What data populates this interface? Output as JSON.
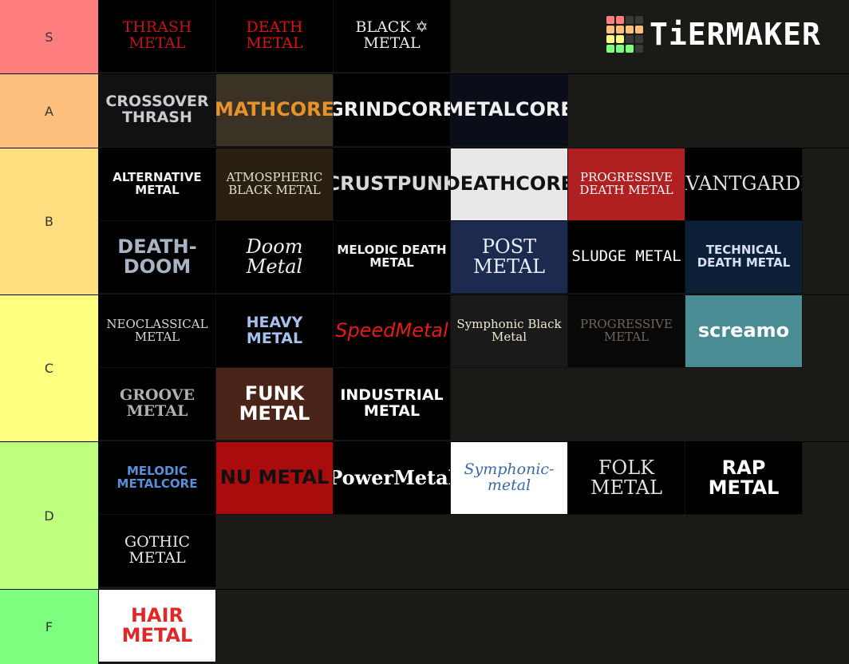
{
  "brand": {
    "name": "TiERMAKER",
    "grid_colors": [
      "#ff7f7f",
      "#ff7f7f",
      "#3a3a3a",
      "#3a3a3a",
      "#ffbf7f",
      "#ffbf7f",
      "#ffbf7f",
      "#ffbf7f",
      "#ffff7f",
      "#ffff7f",
      "#3a3a3a",
      "#3a3a3a",
      "#7fff7f",
      "#7fff7f",
      "#7fff7f",
      "#3a3a3a"
    ]
  },
  "tiers": [
    {
      "label": "S",
      "color": "#ff7f7f",
      "items": [
        {
          "text": "THRASH METAL",
          "fg": "#c0141a",
          "bg": "#000000",
          "font": "serif"
        },
        {
          "text": "DEATH METAL",
          "fg": "#e01010",
          "bg": "#000000",
          "font": "serif"
        },
        {
          "text": "BLACK ✡ METAL",
          "fg": "#e8e8e8",
          "bg": "#000000",
          "font": "serif"
        }
      ]
    },
    {
      "label": "A",
      "color": "#ffbf7f",
      "items": [
        {
          "text": "CROSSOVER THRASH",
          "fg": "#c8ccd0",
          "bg": "#111111",
          "font": "sans"
        },
        {
          "text": "MATHCORE",
          "fg": "#e8922a",
          "bg": "#3a3224",
          "font": "sans"
        },
        {
          "text": "GRINDCORE",
          "fg": "#f0f0f0",
          "bg": "#000000",
          "font": "sans"
        },
        {
          "text": "METALCORE",
          "fg": "#f0f0f0",
          "bg": "#0a0e18",
          "font": "sans"
        }
      ]
    },
    {
      "label": "B",
      "color": "#ffdf7f",
      "items": [
        {
          "text": "ALTERNATIVE METAL",
          "fg": "#f0f0f0",
          "bg": "#000000",
          "font": "sans"
        },
        {
          "text": "ATMOSPHERIC BLACK METAL",
          "fg": "#e6e0d0",
          "bg": "#2a2010",
          "font": "serif"
        },
        {
          "text": "CRUSTPUNK",
          "fg": "#d8d8d8",
          "bg": "#000000",
          "font": "sans"
        },
        {
          "text": "DEATHCORE",
          "fg": "#111111",
          "bg": "#e8e8e8",
          "font": "sans"
        },
        {
          "text": "PROGRESSIVE DEATH METAL",
          "fg": "#ffffff",
          "bg": "#b02020",
          "font": "serif"
        },
        {
          "text": "AVANTGARDE",
          "fg": "#e0e0e0",
          "bg": "#000000",
          "font": "serif"
        },
        {
          "text": "DEATH-DOOM",
          "fg": "#a8b4c4",
          "bg": "#000000",
          "font": "sans"
        },
        {
          "text": "Doom Metal",
          "fg": "#f0f0f0",
          "bg": "#000000",
          "font": "serif-italic"
        },
        {
          "text": "MELODIC DEATH METAL",
          "fg": "#f0f0f0",
          "bg": "#000000",
          "font": "sans"
        },
        {
          "text": "POST METAL",
          "fg": "#e8eef8",
          "bg": "#1c2a50",
          "font": "serif"
        },
        {
          "text": "SLUDGE METAL",
          "fg": "#ffffff",
          "bg": "#000000",
          "font": "mono"
        },
        {
          "text": "TECHNICAL DEATH METAL",
          "fg": "#d8e0f0",
          "bg": "#0c2038",
          "font": "sans"
        }
      ]
    },
    {
      "label": "C",
      "color": "#ffff7f",
      "items": [
        {
          "text": "NEOCLASSICAL METAL",
          "fg": "#d8d8d8",
          "bg": "#000000",
          "font": "serif"
        },
        {
          "text": "HEAVY METAL",
          "fg": "#a8c0f0",
          "bg": "#000000",
          "font": "sans"
        },
        {
          "text": "SpeedMetal",
          "fg": "#e81818",
          "bg": "#000000",
          "font": "sans-italic"
        },
        {
          "text": "Symphonic Black Metal",
          "fg": "#ecead0",
          "bg": "#1a1a1a",
          "font": "serif"
        },
        {
          "text": "PROGRESSIVE METAL",
          "fg": "#6e6658",
          "bg": "#080808",
          "font": "serif"
        },
        {
          "text": "screamo",
          "fg": "#ffffff",
          "bg": "#4a8c94",
          "font": "sans"
        },
        {
          "text": "GROOVE METAL",
          "fg": "#b0b0b0",
          "bg": "#000000",
          "font": "serif-bold"
        },
        {
          "text": "FUNK METAL",
          "fg": "#ffffff",
          "bg": "#4a2418",
          "font": "sans"
        },
        {
          "text": "INDUSTRIAL METAL",
          "fg": "#ffffff",
          "bg": "#000000",
          "font": "sans"
        }
      ]
    },
    {
      "label": "D",
      "color": "#bfff7f",
      "items": [
        {
          "text": "MELODIC METALCORE",
          "fg": "#5890d8",
          "bg": "#000000",
          "font": "sans"
        },
        {
          "text": "NU METAL",
          "fg": "#111111",
          "bg": "#a80c0c",
          "font": "sans"
        },
        {
          "text": "PowerMetal",
          "fg": "#ffffff",
          "bg": "#000000",
          "font": "serif-bold"
        },
        {
          "text": "Symphonic-metal",
          "fg": "#3a6aa8",
          "bg": "#ffffff",
          "font": "serif-italic"
        },
        {
          "text": "FOLK METAL",
          "fg": "#e0e0e0",
          "bg": "#000000",
          "font": "serif"
        },
        {
          "text": "RAP METAL",
          "fg": "#ffffff",
          "bg": "#000000",
          "font": "sans-bold"
        },
        {
          "text": "GOTHIC METAL",
          "fg": "#e8e8e8",
          "bg": "#000000",
          "font": "serif"
        }
      ]
    },
    {
      "label": "F",
      "color": "#7fff7f",
      "items": [
        {
          "text": "HAIR METAL",
          "fg": "#e02828",
          "bg": "#ffffff",
          "font": "sans-bold"
        }
      ]
    }
  ]
}
